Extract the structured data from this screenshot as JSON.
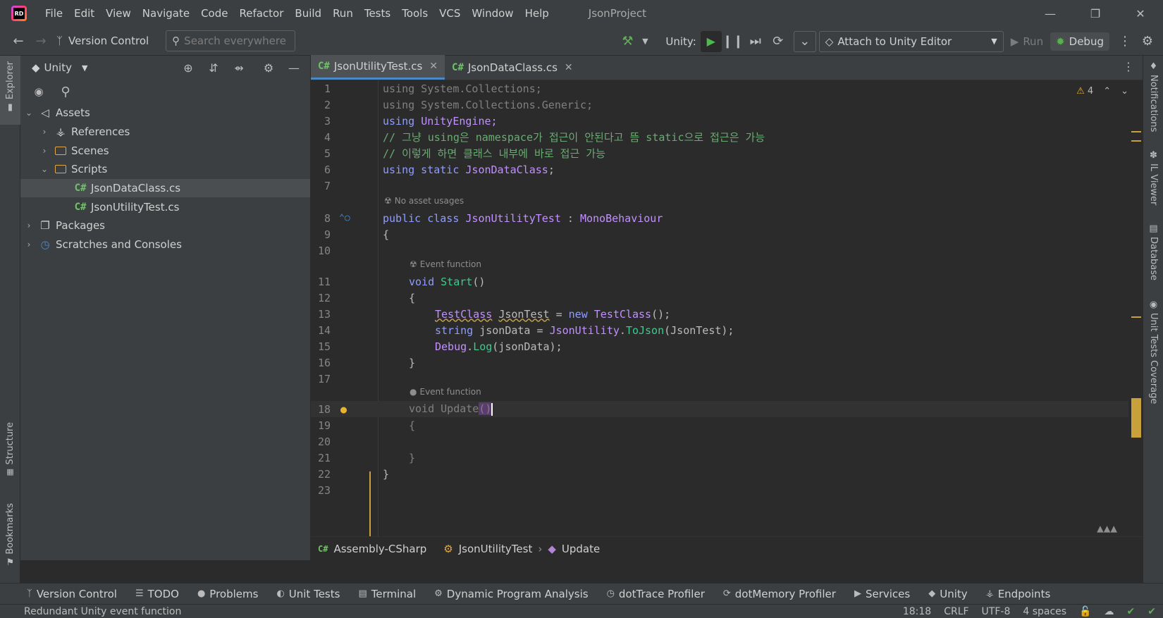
{
  "menu": {
    "items": [
      "File",
      "Edit",
      "View",
      "Navigate",
      "Code",
      "Refactor",
      "Build",
      "Run",
      "Tests",
      "Tools",
      "VCS",
      "Window",
      "Help"
    ],
    "project_name": "JsonProject",
    "logo_text": "RD"
  },
  "toolbar": {
    "version_control": "Version Control",
    "search_placeholder": "Search everywhere",
    "unity_label": "Unity:",
    "attach_label": "Attach to Unity Editor",
    "run_label": "Run",
    "debug_label": "Debug"
  },
  "explorer": {
    "title": "Unity",
    "tree": [
      {
        "label": "Assets"
      },
      {
        "label": "References"
      },
      {
        "label": "Scenes"
      },
      {
        "label": "Scripts"
      },
      {
        "label": "JsonDataClass.cs"
      },
      {
        "label": "JsonUtilityTest.cs"
      },
      {
        "label": "Packages"
      },
      {
        "label": "Scratches and Consoles"
      }
    ],
    "cs_badge": "C#"
  },
  "left_strip": {
    "explorer": "Explorer",
    "structure": "Structure",
    "bookmarks": "Bookmarks"
  },
  "right_strip": {
    "notifications": "Notifications",
    "il_viewer": "IL Viewer",
    "database": "Database",
    "coverage": "Unit Tests Coverage"
  },
  "editor": {
    "tabs": [
      {
        "label": "JsonUtilityTest.cs"
      },
      {
        "label": "JsonDataClass.cs"
      }
    ],
    "warning_count": "4",
    "hints": {
      "no_asset_usages": "No asset usages",
      "event_function": "Event function"
    },
    "line_numbers": [
      "1",
      "2",
      "3",
      "4",
      "5",
      "6",
      "7",
      "8",
      "9",
      "10",
      "11",
      "12",
      "13",
      "14",
      "15",
      "16",
      "17",
      "18",
      "19",
      "20",
      "21",
      "22",
      "23"
    ],
    "code": {
      "l1": "using System.Collections;",
      "l2": "using System.Collections.Generic;",
      "l3_kw": "using",
      "l3_ns": "UnityEngine;",
      "l4": "// 그냥 using은 namespace가 접근이 안된다고 뜸 static으로 접근은 가능",
      "l5": "// 이렇게 하면 클래스 내부에 바로 접근 가능",
      "l6_kw": "using static",
      "l6_cls": "JsonDataClass",
      "l6_end": ";",
      "l8_kw": "public class",
      "l8_cls": "JsonUtilityTest",
      "l8_colon": " : ",
      "l8_base": "MonoBehaviour",
      "brace_open": "{",
      "brace_close": "}",
      "l11_kw": "void",
      "l11_fn": "Start",
      "l11_end": "()",
      "l13_cls": "TestClass",
      "l13_var": "JsonTest",
      "l13_eq": " = ",
      "l13_new": "new",
      "l13_cls2": "TestClass",
      "l13_end": "();",
      "l14_kw": "string",
      "l14_var": " jsonData = ",
      "l14_cls": "JsonUtility",
      "l14_dot": ".",
      "l14_fn": "ToJson",
      "l14_end": "(JsonTest);",
      "l15_cls": "Debug",
      "l15_dot": ".",
      "l15_fn": "Log",
      "l15_end": "(jsonData);",
      "l18_kw": "void",
      "l18_fn": "Update",
      "l18_paren": "()"
    },
    "breadcrumbs": {
      "assembly": "Assembly-CSharp",
      "class": "JsonUtilityTest",
      "method": "Update"
    }
  },
  "bottom_bar": {
    "items": [
      "Version Control",
      "TODO",
      "Problems",
      "Unit Tests",
      "Terminal",
      "Dynamic Program Analysis",
      "dotTrace Profiler",
      "dotMemory Profiler",
      "Services",
      "Unity",
      "Endpoints"
    ]
  },
  "status": {
    "message": "Redundant Unity event function",
    "position": "18:18",
    "line_ending": "CRLF",
    "encoding": "UTF-8",
    "indent": "4 spaces"
  }
}
